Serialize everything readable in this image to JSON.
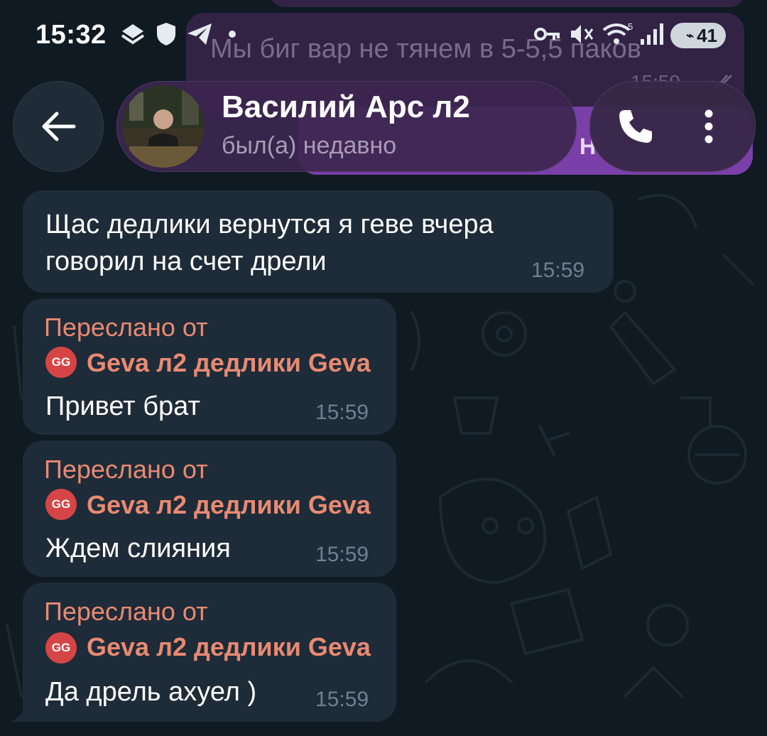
{
  "status_bar": {
    "time": "15:32",
    "battery": "41",
    "icons": [
      "shield-stack-icon",
      "shield-icon",
      "telegram-icon",
      "dot-icon",
      "key-icon",
      "mute-icon",
      "wifi-icon",
      "signal-icon",
      "battery-icon"
    ]
  },
  "background_messages": {
    "outgoing_text": "Мы биг вар не тянем в 5-5,5 паков",
    "outgoing_time": "15:59",
    "outgoing_partial": "Н"
  },
  "header": {
    "contact_name": "Василий Арс л2",
    "contact_status": "был(а) недавно",
    "icons": [
      "back-arrow-icon",
      "phone-icon",
      "more-vert-icon"
    ]
  },
  "messages": [
    {
      "text_lines": [
        "Щас дедлики вернутся я геве вчера",
        "говорил на счет дрели"
      ],
      "time": "15:59"
    },
    {
      "forwarded_label": "Переслано от",
      "sender_initials": "GG",
      "sender": "Geva л2 дедлики Geva",
      "text": "Привет брат",
      "time": "15:59"
    },
    {
      "forwarded_label": "Переслано от",
      "sender_initials": "GG",
      "sender": "Geva л2 дедлики Geva",
      "text": "Ждем слияния",
      "time": "15:59"
    },
    {
      "forwarded_label": "Переслано от",
      "sender_initials": "GG",
      "sender": "Geva л2 дедлики Geva",
      "text": "Да дрель ахуел )",
      "time": "15:59"
    }
  ],
  "colors": {
    "background": "#0f1a22",
    "incoming_bubble": "#1e2b38",
    "forward_accent": "#e88a72",
    "outgoing_bubble": "#3c2650",
    "timestamp": "#6f8190"
  }
}
